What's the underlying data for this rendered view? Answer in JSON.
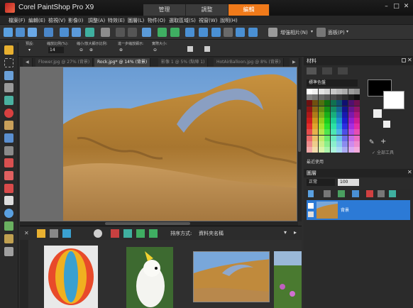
{
  "app": {
    "title": "Corel PaintShop Pro X9"
  },
  "workspace_tabs": [
    {
      "label": "管理"
    },
    {
      "label": "調整"
    },
    {
      "label": "編輯"
    }
  ],
  "window_controls": {
    "minimize": "–",
    "maximize": "□",
    "close": "✕"
  },
  "menu": {
    "items": [
      "檔案(F)",
      "編輯(E)",
      "檢視(V)",
      "影像(I)",
      "調整(A)",
      "特效(E)",
      "圖層(L)",
      "物件(O)",
      "選取區域(S)",
      "視窗(W)",
      "說明(H)"
    ]
  },
  "toolbar": {
    "enhance_label": "增強相片(N)",
    "panel_label": "面板(P)"
  },
  "options": {
    "mode_label": "預設:",
    "zoom_label": "縮放比例(%):",
    "zoom_value": "14",
    "zoom_in_out_label": "縮小/放大顯示比例:",
    "step_label": "進一步縮放顯示:",
    "actual_label": "實際大小:"
  },
  "doc_tabs": [
    {
      "label": "Flower.jpg @ 27% (背景)"
    },
    {
      "label": "Rock.jpg* @ 14% (背景)"
    },
    {
      "label": "影像 1 @ 5% (點陣 1)"
    },
    {
      "label": "HotAirBalloon.jpg @ 8% (背景)"
    }
  ],
  "organizer": {
    "sort_label": "排序方式:",
    "sort_value": "資料夾名稱"
  },
  "materials": {
    "title": "材料",
    "palette_label": "標準色盤",
    "all_tools_label": "全部工具",
    "recent_label": "最近使用"
  },
  "layers": {
    "title": "圖層",
    "blend_mode": "正常",
    "opacity": "100",
    "layer_name": "背景"
  },
  "colors": {
    "accent": "#f07a1a",
    "selection": "#2c7ad6"
  }
}
